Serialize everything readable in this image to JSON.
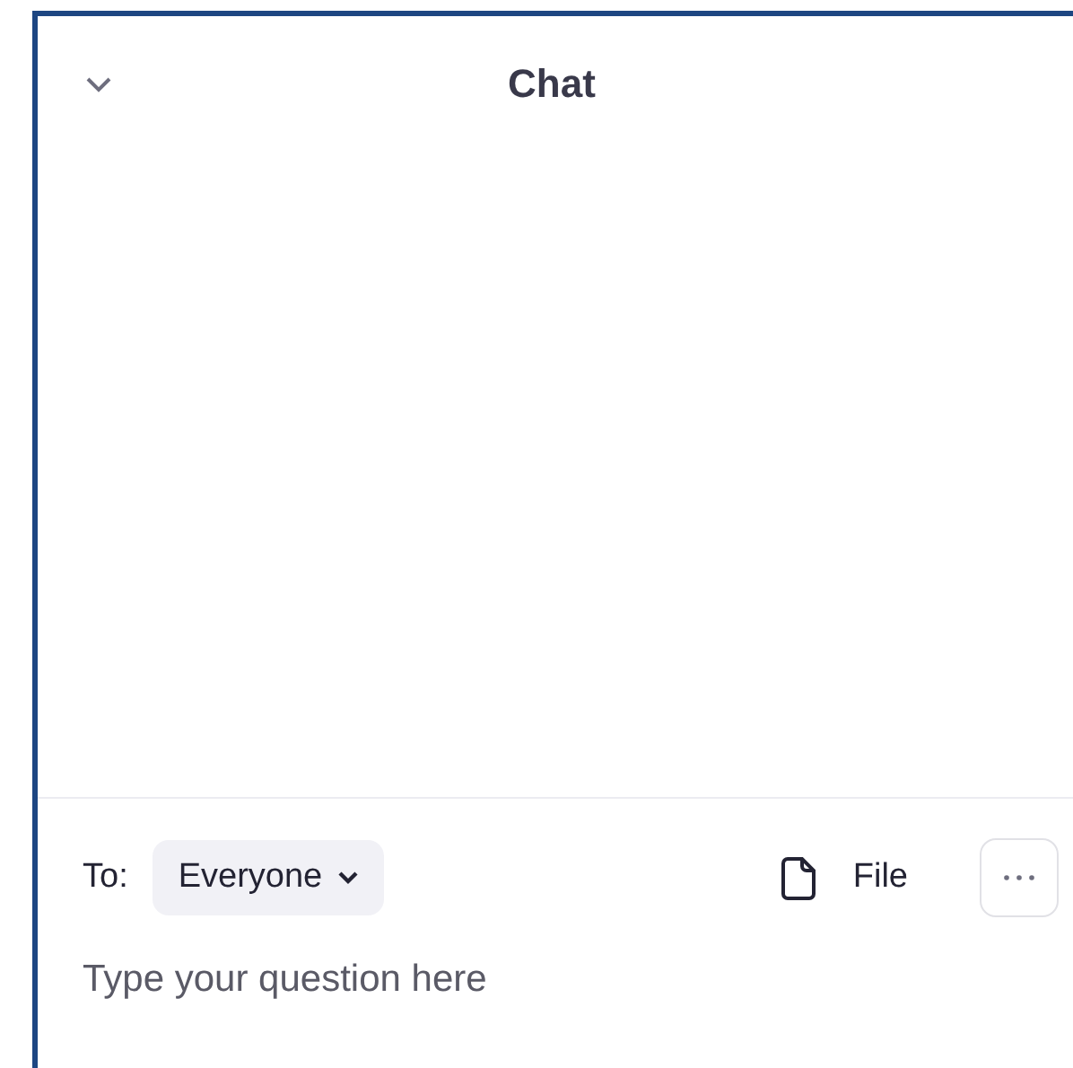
{
  "header": {
    "title": "Chat"
  },
  "composer": {
    "to_label": "To:",
    "recipient": "Everyone",
    "file_button": "File",
    "placeholder": "Type your question here"
  }
}
